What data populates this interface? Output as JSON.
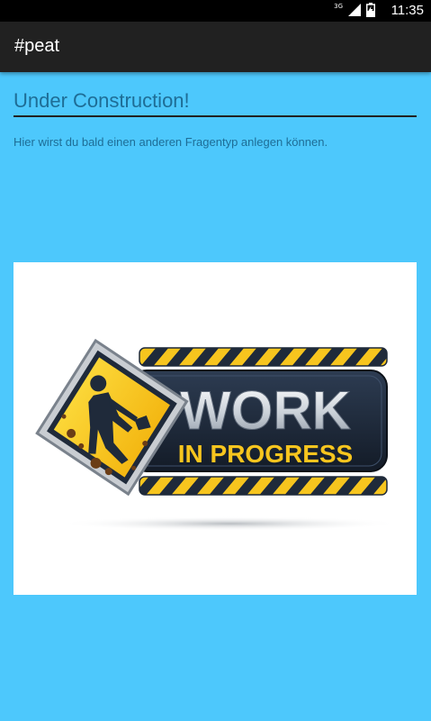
{
  "status_bar": {
    "network": "3G",
    "time": "11:35",
    "icons": [
      "signal-icon",
      "battery-icon"
    ]
  },
  "app_bar": {
    "title": "#peat"
  },
  "content": {
    "heading": "Under Construction!",
    "description": "Hier wirst du bald einen anderen Fragentyp anlegen können.",
    "image": {
      "alt": "work-in-progress-sign",
      "line1": "WORK",
      "line2": "IN PROGRESS"
    }
  },
  "colors": {
    "background": "#4dc8fc",
    "app_bar": "#212121",
    "heading_text": "#1e6d96",
    "sign_yellow": "#f7c51e",
    "sign_dark": "#1f2a3a"
  }
}
